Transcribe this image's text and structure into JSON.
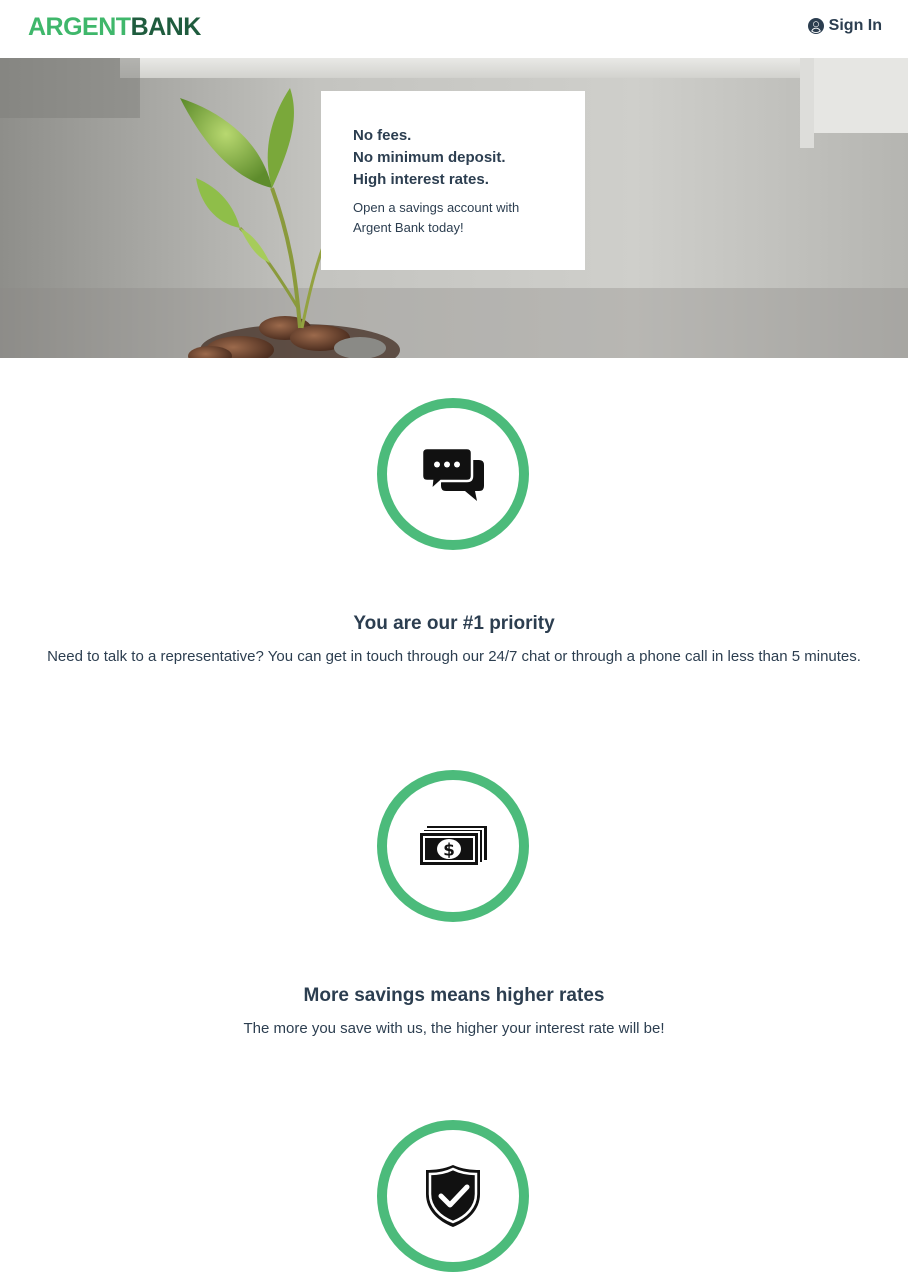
{
  "nav": {
    "logo": {
      "part1": "ARGENT",
      "part2": "BANK"
    },
    "signin_label": "Sign In",
    "signin_icon": "user-circle-icon"
  },
  "hero": {
    "subtitles": [
      "No fees.",
      "No minimum deposit.",
      "High interest rates."
    ],
    "text": "Open a savings account with Argent Bank today!"
  },
  "features": [
    {
      "icon": "chat-icon",
      "title": "You are our #1 priority",
      "text": "Need to talk to a representative? You can get in touch through our 24/7 chat or through a phone call in less than 5 minutes."
    },
    {
      "icon": "money-icon",
      "title": "More savings means higher rates",
      "text": "The more you save with us, the higher your interest rate will be!"
    },
    {
      "icon": "security-shield-icon",
      "title": "",
      "text": ""
    }
  ],
  "colors": {
    "accent": "#4cbb7b",
    "logo_light": "#3fb76b",
    "logo_dark": "#1f5c3e",
    "text": "#2c3e50"
  }
}
